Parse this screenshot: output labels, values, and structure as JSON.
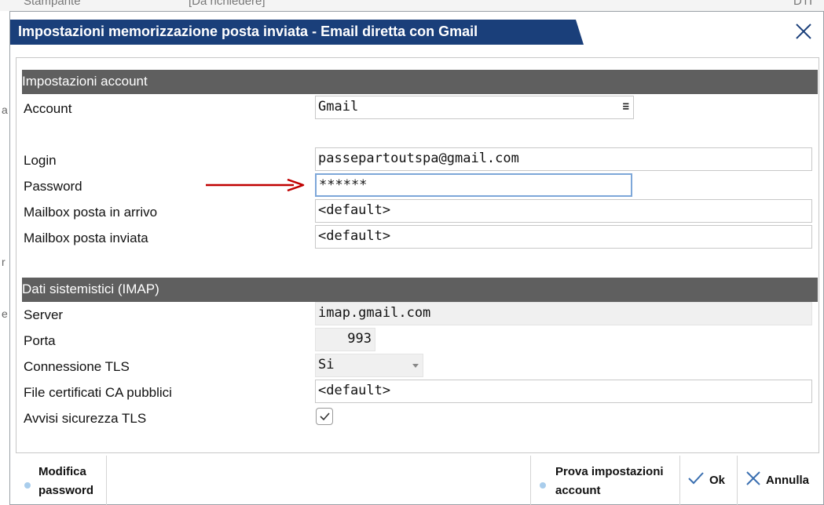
{
  "background": {
    "top_texts": [
      "Stampante",
      "[Da richiedere]",
      "DTI"
    ],
    "side_chars": [
      "a",
      "r",
      "e"
    ]
  },
  "dialog": {
    "title": "Impostazioni memorizzazione posta inviata - Email diretta con Gmail",
    "close_icon": "close-icon"
  },
  "sections": {
    "account_header": "Impostazioni account",
    "imap_header": "Dati sistemistici (IMAP)"
  },
  "fields": {
    "account": {
      "label": "Account",
      "value": "Gmail",
      "icon": "menu-icon"
    },
    "login": {
      "label": "Login",
      "value": "passepartoutspa@gmail.com"
    },
    "password": {
      "label": "Password",
      "value": "******"
    },
    "mailbox_in": {
      "label": "Mailbox posta in arrivo",
      "value": "<default>"
    },
    "mailbox_out": {
      "label": "Mailbox posta inviata",
      "value": "<default>"
    },
    "server": {
      "label": "Server",
      "value": "imap.gmail.com"
    },
    "porta": {
      "label": "Porta",
      "value": "993"
    },
    "tls": {
      "label": "Connessione TLS",
      "value": "Si"
    },
    "ca_file": {
      "label": "File certificati CA pubblici",
      "value": "<default>"
    },
    "tls_warn": {
      "label": "Avvisi sicurezza TLS",
      "checked": true
    }
  },
  "footer": {
    "modifica_line1": "Modifica",
    "modifica_line2": "password",
    "prova_line1": "Prova impostazioni",
    "prova_line2": "account",
    "ok_label": "Ok",
    "annulla_label": "Annulla"
  },
  "colors": {
    "title_bar": "#1a3f7a",
    "section_header": "#5f5f5f",
    "annotation_arrow": "#c00000",
    "focus_border": "#7da7d9",
    "bullet": "#a9cdec",
    "ok_icon": "#3a6fb0",
    "annulla_icon": "#3a6fb0"
  }
}
